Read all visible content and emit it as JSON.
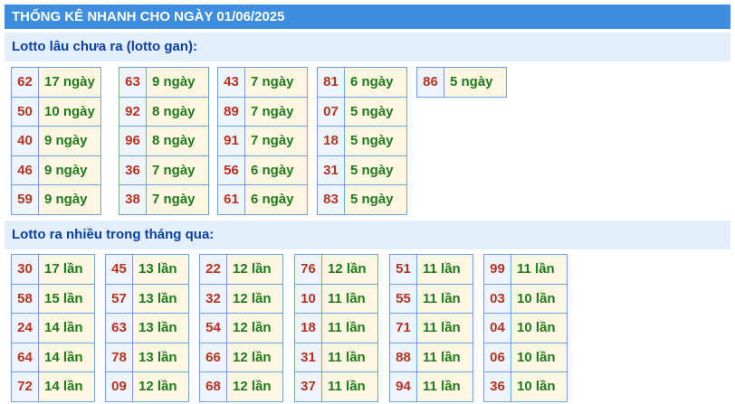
{
  "title": "THỐNG KÊ NHANH CHO NGÀY 01/06/2025",
  "section1": {
    "heading": "Lotto lâu chưa ra (lotto gan):",
    "groups": [
      [
        [
          "62",
          "17 ngày"
        ],
        [
          "50",
          "10 ngày"
        ],
        [
          "40",
          "9 ngày"
        ],
        [
          "46",
          "9 ngày"
        ],
        [
          "59",
          "9 ngày"
        ]
      ],
      [
        [
          "63",
          "9 ngày"
        ],
        [
          "92",
          "8 ngày"
        ],
        [
          "96",
          "8 ngày"
        ],
        [
          "36",
          "7 ngày"
        ],
        [
          "38",
          "7 ngày"
        ]
      ],
      [
        [
          "43",
          "7 ngày"
        ],
        [
          "89",
          "7 ngày"
        ],
        [
          "91",
          "7 ngày"
        ],
        [
          "56",
          "6 ngày"
        ],
        [
          "61",
          "6 ngày"
        ]
      ],
      [
        [
          "81",
          "6 ngày"
        ],
        [
          "07",
          "5 ngày"
        ],
        [
          "18",
          "5 ngày"
        ],
        [
          "31",
          "5 ngày"
        ],
        [
          "83",
          "5 ngày"
        ]
      ],
      [
        [
          "86",
          "5 ngày"
        ]
      ]
    ]
  },
  "section2": {
    "heading": "Lotto ra nhiều trong tháng qua:",
    "groups": [
      [
        [
          "30",
          "17 lần"
        ],
        [
          "58",
          "15 lần"
        ],
        [
          "24",
          "14 lần"
        ],
        [
          "64",
          "14 lần"
        ],
        [
          "72",
          "14 lần"
        ]
      ],
      [
        [
          "45",
          "13 lần"
        ],
        [
          "57",
          "13 lần"
        ],
        [
          "63",
          "13 lần"
        ],
        [
          "78",
          "13 lần"
        ],
        [
          "09",
          "12 lần"
        ]
      ],
      [
        [
          "22",
          "12 lần"
        ],
        [
          "32",
          "12 lần"
        ],
        [
          "54",
          "12 lần"
        ],
        [
          "66",
          "12 lần"
        ],
        [
          "68",
          "12 lần"
        ]
      ],
      [
        [
          "76",
          "12 lần"
        ],
        [
          "10",
          "11 lần"
        ],
        [
          "18",
          "11 lần"
        ],
        [
          "31",
          "11 lần"
        ],
        [
          "37",
          "11 lần"
        ]
      ],
      [
        [
          "51",
          "11 lần"
        ],
        [
          "55",
          "11 lần"
        ],
        [
          "71",
          "11 lần"
        ],
        [
          "88",
          "11 lần"
        ],
        [
          "94",
          "11 lần"
        ]
      ],
      [
        [
          "99",
          "11 lần"
        ],
        [
          "03",
          "10 lần"
        ],
        [
          "04",
          "10 lần"
        ],
        [
          "06",
          "10 lần"
        ],
        [
          "36",
          "10 lần"
        ]
      ]
    ]
  }
}
